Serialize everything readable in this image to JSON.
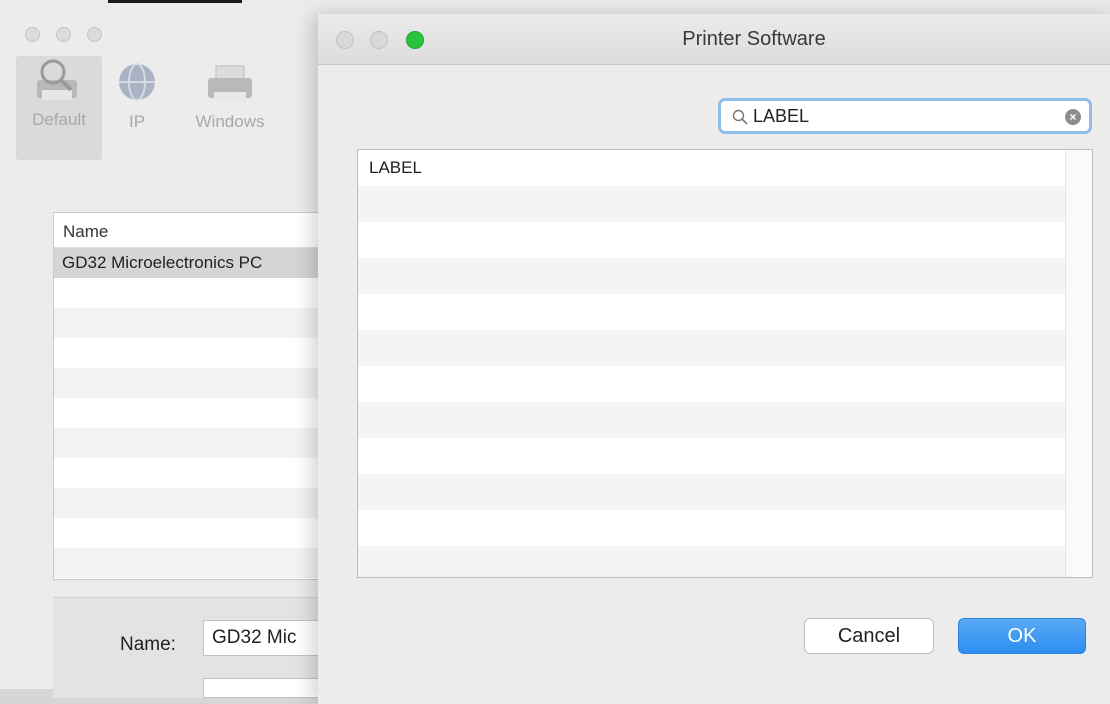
{
  "background_window": {
    "toolbar": [
      {
        "label": "Default",
        "icon": "magnifier-printer-icon"
      },
      {
        "label": "IP",
        "icon": "globe-icon"
      },
      {
        "label": "Windows",
        "icon": "printer-icon"
      }
    ],
    "list": {
      "header": "Name",
      "rows": [
        "GD32 Microelectronics PC"
      ]
    },
    "name_label": "Name:",
    "name_value": "GD32 Mic"
  },
  "dialog": {
    "title": "Printer Software",
    "search": {
      "value": "LABEL"
    },
    "list": {
      "rows": [
        "LABEL"
      ]
    },
    "buttons": {
      "cancel": "Cancel",
      "ok": "OK"
    },
    "colors": {
      "ok_button": "#2c8ef0",
      "zoom_button": "#2bc33c",
      "search_focus": "#8fbde9"
    }
  }
}
